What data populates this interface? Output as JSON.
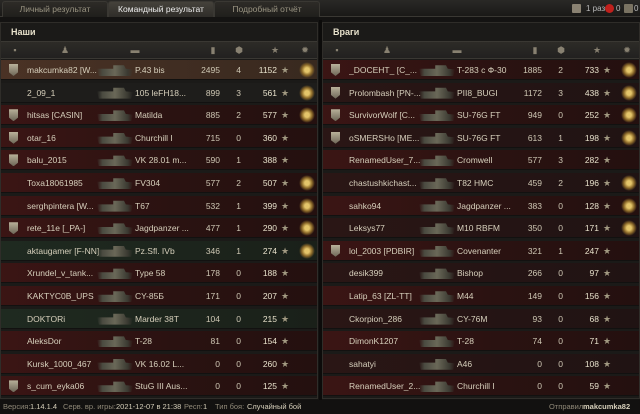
{
  "tabs": [
    "Личный результат",
    "Командный результат",
    "Подробный отчёт"
  ],
  "top_right": {
    "count_label": "1 раз",
    "hearts": "0",
    "shield": "0"
  },
  "left": {
    "title": "Наши",
    "rows": [
      {
        "name": "makcumka82 [W...",
        "tank": "P.43 bis",
        "dmg": "2495",
        "kills": "4",
        "xp": "1152",
        "style": "me",
        "badge": true,
        "medal": true
      },
      {
        "name": "2_09_1",
        "tank": "105 leFH18...",
        "dmg": "899",
        "kills": "3",
        "xp": "561",
        "style": "gray",
        "badge": false,
        "medal": true
      },
      {
        "name": "hitsas [CASIN]",
        "tank": "Matilda",
        "dmg": "885",
        "kills": "2",
        "xp": "577",
        "style": "red",
        "badge": true,
        "medal": true
      },
      {
        "name": "otar_16",
        "tank": "Churchill I",
        "dmg": "715",
        "kills": "0",
        "xp": "360",
        "style": "red",
        "badge": true,
        "medal": false
      },
      {
        "name": "balu_2015",
        "tank": "VK 28.01 m...",
        "dmg": "590",
        "kills": "1",
        "xp": "388",
        "style": "red",
        "badge": true,
        "medal": false
      },
      {
        "name": "Toxa18061985",
        "tank": "FV304",
        "dmg": "577",
        "kills": "2",
        "xp": "507",
        "style": "red",
        "badge": false,
        "medal": true
      },
      {
        "name": "serghpintera [W...",
        "tank": "T67",
        "dmg": "532",
        "kills": "1",
        "xp": "399",
        "style": "red",
        "badge": false,
        "medal": true
      },
      {
        "name": "rete_11e [_PA-]",
        "tank": "Jagdpanzer ...",
        "dmg": "477",
        "kills": "1",
        "xp": "290",
        "style": "red",
        "badge": true,
        "medal": true
      },
      {
        "name": "aktaugamer [F-NN]",
        "tank": "Pz.Sfl. IVb",
        "dmg": "346",
        "kills": "1",
        "xp": "274",
        "style": "sq",
        "badge": false,
        "medal": true
      },
      {
        "name": "Xrundel_v_tank...",
        "tank": "Type 58",
        "dmg": "178",
        "kills": "0",
        "xp": "188",
        "style": "red",
        "badge": false,
        "medal": false
      },
      {
        "name": "KAKTYC0B_UPS",
        "tank": "CY-85Б",
        "dmg": "171",
        "kills": "0",
        "xp": "207",
        "style": "red",
        "badge": false,
        "medal": false
      },
      {
        "name": "DOKTORi",
        "tank": "Marder 38T",
        "dmg": "104",
        "kills": "0",
        "xp": "215",
        "style": "sq",
        "badge": false,
        "medal": false
      },
      {
        "name": "AleksDor",
        "tank": "T-28",
        "dmg": "81",
        "kills": "0",
        "xp": "154",
        "style": "red",
        "badge": false,
        "medal": false
      },
      {
        "name": "Kursk_1000_467",
        "tank": "VK 16.02 L...",
        "dmg": "0",
        "kills": "0",
        "xp": "260",
        "style": "red",
        "badge": false,
        "medal": false
      },
      {
        "name": "s_cum_eyka06",
        "tank": "StuG III Aus...",
        "dmg": "0",
        "kills": "0",
        "xp": "125",
        "style": "red",
        "badge": true,
        "medal": false
      }
    ]
  },
  "right": {
    "title": "Враги",
    "rows": [
      {
        "name": "_DOCEHT_ [C_...",
        "tank": "T-283 с Ф-30",
        "dmg": "1885",
        "kills": "2",
        "xp": "733",
        "badge": true,
        "medal": true
      },
      {
        "name": "Prolombash [PN-...",
        "tank": "PII8_BUGI",
        "dmg": "1172",
        "kills": "3",
        "xp": "438",
        "badge": true,
        "medal": true
      },
      {
        "name": "SurvivorWolf [C...",
        "tank": "SU-76G FT",
        "dmg": "949",
        "kills": "0",
        "xp": "252",
        "badge": true,
        "medal": true
      },
      {
        "name": "oSMERSHo [ME...",
        "tank": "SU-76G FT",
        "dmg": "613",
        "kills": "1",
        "xp": "198",
        "badge": true,
        "medal": true
      },
      {
        "name": "RenamedUser_7...",
        "tank": "Cromwell",
        "dmg": "577",
        "kills": "3",
        "xp": "282",
        "badge": false,
        "medal": false
      },
      {
        "name": "chastushkichast...",
        "tank": "T82 HMC",
        "dmg": "459",
        "kills": "2",
        "xp": "196",
        "badge": false,
        "medal": true
      },
      {
        "name": "sahko94",
        "tank": "Jagdpanzer ...",
        "dmg": "383",
        "kills": "0",
        "xp": "128",
        "badge": false,
        "medal": true
      },
      {
        "name": "Leksys77",
        "tank": "M10 RBFM",
        "dmg": "350",
        "kills": "0",
        "xp": "171",
        "badge": false,
        "medal": true
      },
      {
        "name": "lol_2003 [PDBIR]",
        "tank": "Covenanter",
        "dmg": "321",
        "kills": "1",
        "xp": "247",
        "badge": true,
        "medal": false
      },
      {
        "name": "desik399",
        "tank": "Bishop",
        "dmg": "266",
        "kills": "0",
        "xp": "97",
        "badge": false,
        "medal": false
      },
      {
        "name": "Latip_63 [ZL-TT]",
        "tank": "M44",
        "dmg": "149",
        "kills": "0",
        "xp": "156",
        "badge": false,
        "medal": false
      },
      {
        "name": "Ckorpion_286",
        "tank": "CY-76M",
        "dmg": "93",
        "kills": "0",
        "xp": "68",
        "badge": false,
        "medal": false
      },
      {
        "name": "DimonK1207",
        "tank": "T-28",
        "dmg": "74",
        "kills": "0",
        "xp": "71",
        "badge": false,
        "medal": false
      },
      {
        "name": "sahatyi",
        "tank": "A46",
        "dmg": "0",
        "kills": "0",
        "xp": "108",
        "badge": false,
        "medal": false
      },
      {
        "name": "RenamedUser_2...",
        "tank": "Churchill I",
        "dmg": "0",
        "kills": "0",
        "xp": "59",
        "badge": false,
        "medal": false
      }
    ]
  },
  "footer": {
    "version_label": "Версия:",
    "version": "1.14.1.4",
    "server_time_label": "Серв. вр. игры:",
    "server_time": "2021-12-07 в 21:38",
    "resp_label": "Респ:",
    "resp": "1",
    "battle_type_label": "Тип боя:",
    "battle_type": "Случайный бой",
    "sender_label": "Отправил:",
    "sender": "makcumka82"
  }
}
